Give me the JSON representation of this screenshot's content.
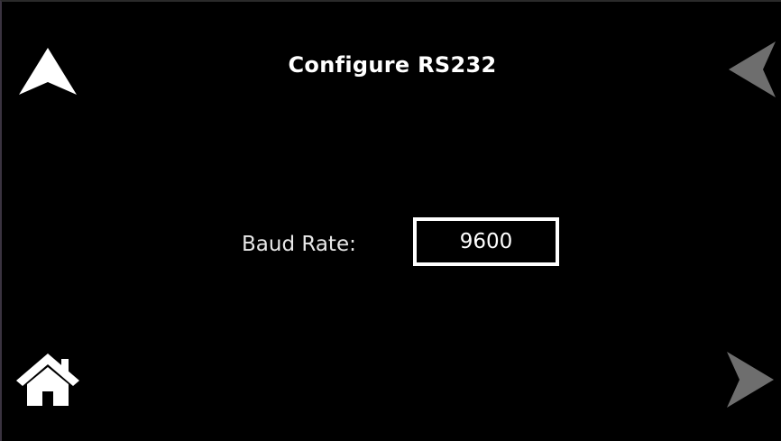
{
  "screen": {
    "title": "Configure RS232"
  },
  "fields": {
    "baud_rate_label": "Baud Rate:",
    "baud_rate_value": "9600"
  },
  "nav": {
    "up_icon": "up-arrow-icon",
    "back_icon": "left-arrow-icon",
    "home_icon": "home-icon",
    "next_icon": "right-arrow-icon"
  },
  "colors": {
    "background": "#000000",
    "text": "#ffffff",
    "disabled_arrow": "#6e6e6e"
  }
}
